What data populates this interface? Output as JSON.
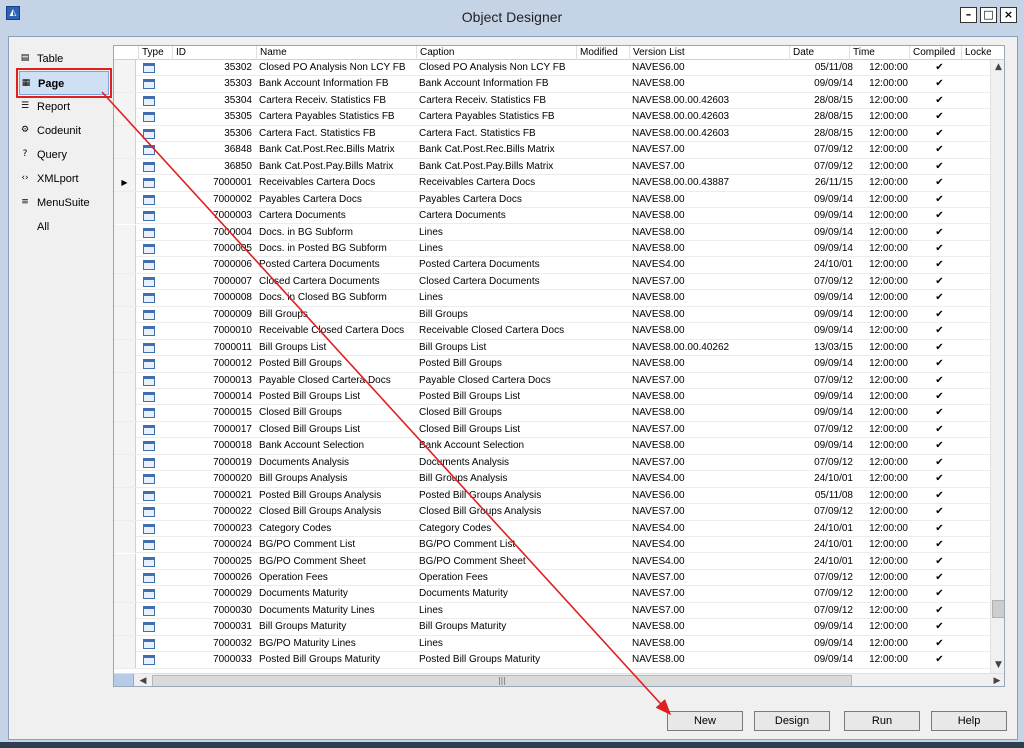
{
  "window": {
    "title": "Object Designer",
    "minimize_label": "–",
    "maximize_label": "□",
    "close_label": "×"
  },
  "sidebar": {
    "items": [
      {
        "label": "Table",
        "icon": "table-icon",
        "glyph": "▤"
      },
      {
        "label": "Page",
        "icon": "page-icon",
        "glyph": "▦",
        "active": true
      },
      {
        "label": "Report",
        "icon": "report-icon",
        "glyph": "☰"
      },
      {
        "label": "Codeunit",
        "icon": "codeunit-icon",
        "glyph": "⚙"
      },
      {
        "label": "Query",
        "icon": "query-icon",
        "glyph": "?"
      },
      {
        "label": "XMLport",
        "icon": "xmlport-icon",
        "glyph": "‹›"
      },
      {
        "label": "MenuSuite",
        "icon": "menusuite-icon",
        "glyph": "≡"
      },
      {
        "label": "All",
        "icon": "",
        "glyph": ""
      }
    ]
  },
  "grid": {
    "columns": [
      "Type",
      "ID",
      "Name",
      "Caption",
      "Modified",
      "Version List",
      "Date",
      "Time",
      "Compiled",
      "Locked"
    ],
    "rows": [
      {
        "id": "35302",
        "name": "Closed PO Analysis Non LCY FB",
        "caption": "Closed PO Analysis Non LCY FB",
        "version": "NAVES6.00",
        "date": "05/11/08",
        "time": "12:00:00",
        "compiled": "✔",
        "selected": false
      },
      {
        "id": "35303",
        "name": "Bank Account Information FB",
        "caption": "Bank Account Information FB",
        "version": "NAVES8.00",
        "date": "09/09/14",
        "time": "12:00:00",
        "compiled": "✔",
        "selected": false
      },
      {
        "id": "35304",
        "name": "Cartera Receiv. Statistics FB",
        "caption": "Cartera Receiv. Statistics FB",
        "version": "NAVES8.00.00.42603",
        "date": "28/08/15",
        "time": "12:00:00",
        "compiled": "✔",
        "selected": false
      },
      {
        "id": "35305",
        "name": "Cartera Payables Statistics FB",
        "caption": "Cartera Payables Statistics FB",
        "version": "NAVES8.00.00.42603",
        "date": "28/08/15",
        "time": "12:00:00",
        "compiled": "✔",
        "selected": false
      },
      {
        "id": "35306",
        "name": "Cartera Fact. Statistics FB",
        "caption": "Cartera Fact. Statistics FB",
        "version": "NAVES8.00.00.42603",
        "date": "28/08/15",
        "time": "12:00:00",
        "compiled": "✔",
        "selected": false
      },
      {
        "id": "36848",
        "name": "Bank Cat.Post.Rec.Bills Matrix",
        "caption": "Bank Cat.Post.Rec.Bills Matrix",
        "version": "NAVES7.00",
        "date": "07/09/12",
        "time": "12:00:00",
        "compiled": "✔",
        "selected": false
      },
      {
        "id": "36850",
        "name": "Bank Cat.Post.Pay.Bills Matrix",
        "caption": "Bank Cat.Post.Pay.Bills Matrix",
        "version": "NAVES7.00",
        "date": "07/09/12",
        "time": "12:00:00",
        "compiled": "✔",
        "selected": false
      },
      {
        "id": "7000001",
        "name": "Receivables Cartera Docs",
        "caption": "Receivables Cartera Docs",
        "version": "NAVES8.00.00.43887",
        "date": "26/11/15",
        "time": "12:00:00",
        "compiled": "✔",
        "selected": true
      },
      {
        "id": "7000002",
        "name": "Payables Cartera Docs",
        "caption": "Payables Cartera Docs",
        "version": "NAVES8.00",
        "date": "09/09/14",
        "time": "12:00:00",
        "compiled": "✔",
        "selected": false
      },
      {
        "id": "7000003",
        "name": "Cartera Documents",
        "caption": "Cartera Documents",
        "version": "NAVES8.00",
        "date": "09/09/14",
        "time": "12:00:00",
        "compiled": "✔",
        "selected": false
      },
      {
        "id": "7000004",
        "name": "Docs. in BG Subform",
        "caption": "Lines",
        "version": "NAVES8.00",
        "date": "09/09/14",
        "time": "12:00:00",
        "compiled": "✔",
        "selected": false
      },
      {
        "id": "7000005",
        "name": "Docs. in Posted BG Subform",
        "caption": "Lines",
        "version": "NAVES8.00",
        "date": "09/09/14",
        "time": "12:00:00",
        "compiled": "✔",
        "selected": false
      },
      {
        "id": "7000006",
        "name": "Posted Cartera Documents",
        "caption": "Posted Cartera Documents",
        "version": "NAVES4.00",
        "date": "24/10/01",
        "time": "12:00:00",
        "compiled": "✔",
        "selected": false
      },
      {
        "id": "7000007",
        "name": "Closed Cartera Documents",
        "caption": "Closed Cartera Documents",
        "version": "NAVES7.00",
        "date": "07/09/12",
        "time": "12:00:00",
        "compiled": "✔",
        "selected": false
      },
      {
        "id": "7000008",
        "name": "Docs. in Closed BG Subform",
        "caption": "Lines",
        "version": "NAVES8.00",
        "date": "09/09/14",
        "time": "12:00:00",
        "compiled": "✔",
        "selected": false
      },
      {
        "id": "7000009",
        "name": "Bill Groups",
        "caption": "Bill Groups",
        "version": "NAVES8.00",
        "date": "09/09/14",
        "time": "12:00:00",
        "compiled": "✔",
        "selected": false
      },
      {
        "id": "7000010",
        "name": "Receivable Closed Cartera Docs",
        "caption": "Receivable Closed Cartera Docs",
        "version": "NAVES8.00",
        "date": "09/09/14",
        "time": "12:00:00",
        "compiled": "✔",
        "selected": false
      },
      {
        "id": "7000011",
        "name": "Bill Groups List",
        "caption": "Bill Groups List",
        "version": "NAVES8.00.00.40262",
        "date": "13/03/15",
        "time": "12:00:00",
        "compiled": "✔",
        "selected": false
      },
      {
        "id": "7000012",
        "name": "Posted Bill Groups",
        "caption": "Posted Bill Groups",
        "version": "NAVES8.00",
        "date": "09/09/14",
        "time": "12:00:00",
        "compiled": "✔",
        "selected": false
      },
      {
        "id": "7000013",
        "name": "Payable Closed Cartera Docs",
        "caption": "Payable Closed Cartera Docs",
        "version": "NAVES7.00",
        "date": "07/09/12",
        "time": "12:00:00",
        "compiled": "✔",
        "selected": false
      },
      {
        "id": "7000014",
        "name": "Posted Bill Groups List",
        "caption": "Posted Bill Groups List",
        "version": "NAVES8.00",
        "date": "09/09/14",
        "time": "12:00:00",
        "compiled": "✔",
        "selected": false
      },
      {
        "id": "7000015",
        "name": "Closed Bill Groups",
        "caption": "Closed Bill Groups",
        "version": "NAVES8.00",
        "date": "09/09/14",
        "time": "12:00:00",
        "compiled": "✔",
        "selected": false
      },
      {
        "id": "7000017",
        "name": "Closed Bill Groups List",
        "caption": "Closed Bill Groups List",
        "version": "NAVES7.00",
        "date": "07/09/12",
        "time": "12:00:00",
        "compiled": "✔",
        "selected": false
      },
      {
        "id": "7000018",
        "name": "Bank Account Selection",
        "caption": "Bank Account Selection",
        "version": "NAVES8.00",
        "date": "09/09/14",
        "time": "12:00:00",
        "compiled": "✔",
        "selected": false
      },
      {
        "id": "7000019",
        "name": "Documents Analysis",
        "caption": "Documents Analysis",
        "version": "NAVES7.00",
        "date": "07/09/12",
        "time": "12:00:00",
        "compiled": "✔",
        "selected": false
      },
      {
        "id": "7000020",
        "name": "Bill Groups Analysis",
        "caption": "Bill Groups Analysis",
        "version": "NAVES4.00",
        "date": "24/10/01",
        "time": "12:00:00",
        "compiled": "✔",
        "selected": false
      },
      {
        "id": "7000021",
        "name": "Posted Bill Groups Analysis",
        "caption": "Posted Bill Groups Analysis",
        "version": "NAVES6.00",
        "date": "05/11/08",
        "time": "12:00:00",
        "compiled": "✔",
        "selected": false
      },
      {
        "id": "7000022",
        "name": "Closed Bill Groups Analysis",
        "caption": "Closed Bill Groups Analysis",
        "version": "NAVES7.00",
        "date": "07/09/12",
        "time": "12:00:00",
        "compiled": "✔",
        "selected": false
      },
      {
        "id": "7000023",
        "name": "Category Codes",
        "caption": "Category Codes",
        "version": "NAVES4.00",
        "date": "24/10/01",
        "time": "12:00:00",
        "compiled": "✔",
        "selected": false
      },
      {
        "id": "7000024",
        "name": "BG/PO Comment List",
        "caption": "BG/PO Comment List",
        "version": "NAVES4.00",
        "date": "24/10/01",
        "time": "12:00:00",
        "compiled": "✔",
        "selected": false
      },
      {
        "id": "7000025",
        "name": "BG/PO Comment Sheet",
        "caption": "BG/PO Comment Sheet",
        "version": "NAVES4.00",
        "date": "24/10/01",
        "time": "12:00:00",
        "compiled": "✔",
        "selected": false
      },
      {
        "id": "7000026",
        "name": "Operation Fees",
        "caption": "Operation Fees",
        "version": "NAVES7.00",
        "date": "07/09/12",
        "time": "12:00:00",
        "compiled": "✔",
        "selected": false
      },
      {
        "id": "7000029",
        "name": "Documents Maturity",
        "caption": "Documents Maturity",
        "version": "NAVES7.00",
        "date": "07/09/12",
        "time": "12:00:00",
        "compiled": "✔",
        "selected": false
      },
      {
        "id": "7000030",
        "name": "Documents Maturity Lines",
        "caption": "Lines",
        "version": "NAVES7.00",
        "date": "07/09/12",
        "time": "12:00:00",
        "compiled": "✔",
        "selected": false
      },
      {
        "id": "7000031",
        "name": "Bill Groups Maturity",
        "caption": "Bill Groups Maturity",
        "version": "NAVES8.00",
        "date": "09/09/14",
        "time": "12:00:00",
        "compiled": "✔",
        "selected": false
      },
      {
        "id": "7000032",
        "name": "BG/PO Maturity Lines",
        "caption": "Lines",
        "version": "NAVES8.00",
        "date": "09/09/14",
        "time": "12:00:00",
        "compiled": "✔",
        "selected": false
      },
      {
        "id": "7000033",
        "name": "Posted Bill Groups Maturity",
        "caption": "Posted Bill Groups Maturity",
        "version": "NAVES8.00",
        "date": "09/09/14",
        "time": "12:00:00",
        "compiled": "✔",
        "selected": false
      }
    ]
  },
  "buttons": {
    "new": "New",
    "design": "Design",
    "run": "Run",
    "help": "Help"
  },
  "colors": {
    "annotation": "#e02020",
    "selection_outline": "#e02020",
    "title_bar": "#c4d3e6"
  }
}
